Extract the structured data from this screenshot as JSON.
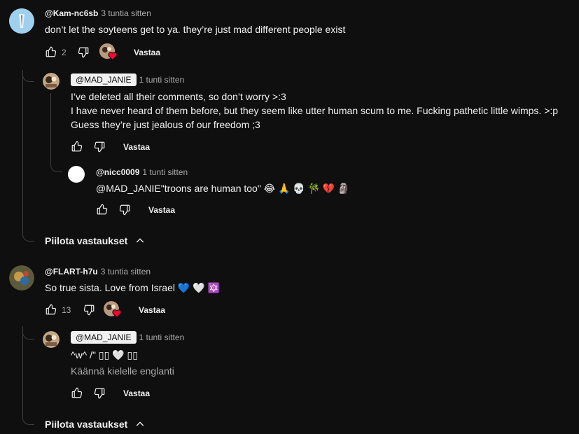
{
  "comments": [
    {
      "author": "@Kam-nc6sb",
      "time": "3 tuntia sitten",
      "text": "don’t let the soyteens get to ya. they’re just mad different people exist",
      "likes": "2",
      "reply_label": "Vastaa",
      "replies": [
        {
          "author": "@MAD_JANIE",
          "time": "1 tunti sitten",
          "lines": [
            "I’ve deleted all their comments, so don’t worry >:3",
            "I have never heard of them before, but they seem like utter human scum to me. Fucking pathetic little wimps. >:p",
            "Guess they’re just jealous of our freedom ;3"
          ],
          "reply_label": "Vastaa"
        },
        {
          "author": "@nicc0009",
          "time": "1 tunti sitten",
          "text": "@MAD_JANIE\"troons are human too\" 😂 🙏 💀 🎋 💔 🗿",
          "reply_label": "Vastaa"
        }
      ],
      "toggle_label": "Piilota vastaukset"
    },
    {
      "author": "@FLART-h7u",
      "time": "3 tuntia sitten",
      "text": "So true sista. Love from Israel 💙 🤍 🔯",
      "likes": "13",
      "reply_label": "Vastaa",
      "replies": [
        {
          "author": "@MAD_JANIE",
          "time": "1 tunti sitten",
          "text": "^w^ /\" ▯▯ 🤍 ▯▯",
          "translate": "Käännä kielelle englanti",
          "reply_label": "Vastaa"
        }
      ],
      "toggle_label": "Piilota vastaukset"
    }
  ],
  "icons": {
    "like": "thumbs-up-icon",
    "dislike": "thumbs-down-icon",
    "creator_heart": "creator-heart-icon",
    "toggle": "chevron-up-icon"
  },
  "colors": {
    "background": "#0f0f0f",
    "text": "#f1f1f1",
    "muted": "#aaaaaa",
    "heart": "#ff0033"
  }
}
